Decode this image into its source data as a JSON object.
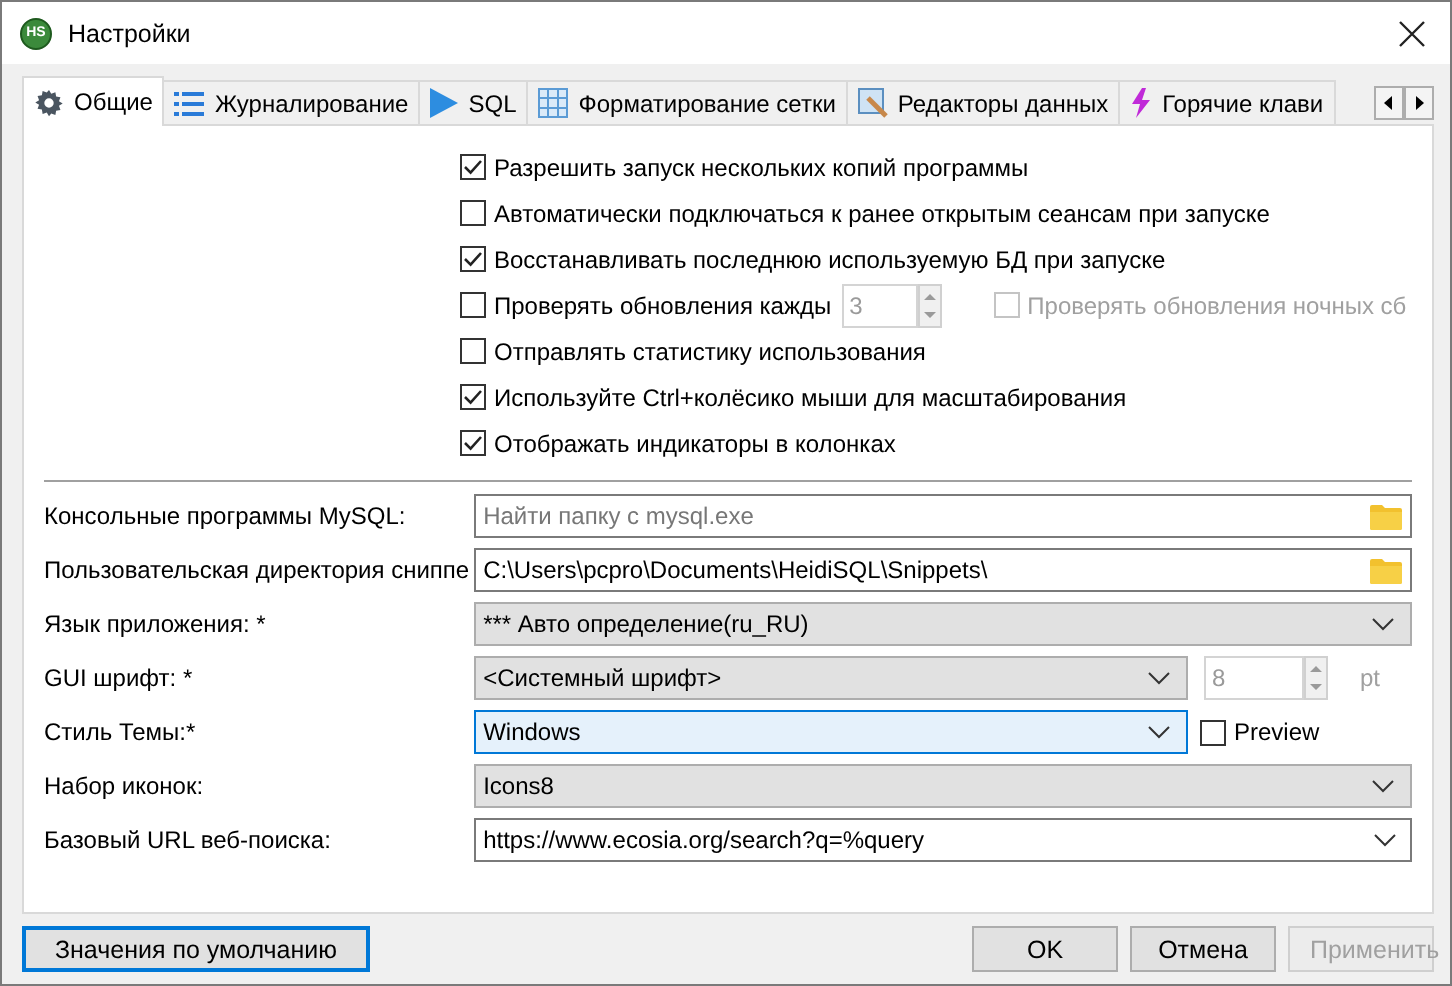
{
  "window": {
    "title": "Настройки",
    "icon_text": "HS"
  },
  "tabs": [
    {
      "label": "Общие",
      "selected": true
    },
    {
      "label": "Журналирование",
      "selected": false
    },
    {
      "label": "SQL",
      "selected": false
    },
    {
      "label": "Форматирование сетки",
      "selected": false
    },
    {
      "label": "Редакторы данных",
      "selected": false
    },
    {
      "label": "Горячие клави",
      "selected": false
    }
  ],
  "checkboxes": [
    {
      "label": "Разрешить запуск нескольких копий программы",
      "checked": true
    },
    {
      "label": "Автоматически подключаться к ранее открытым сеансам при запуске",
      "checked": false
    },
    {
      "label": "Восстанавливать последнюю используемую БД при запуске",
      "checked": true
    },
    {
      "label": "Проверять обновления кажды",
      "checked": false,
      "spin": {
        "value": "3",
        "disabled": true
      },
      "extra": {
        "label": "Проверять обновления ночных сб",
        "checked": false,
        "disabled": true
      }
    },
    {
      "label": "Отправлять статистику использования",
      "checked": false
    },
    {
      "label": "Используйте Ctrl+колёсико мыши для масштабирования",
      "checked": true
    },
    {
      "label": "Отображать индикаторы в колонках",
      "checked": true
    }
  ],
  "fields": [
    {
      "label": "Консольные программы MySQL:",
      "kind": "folder",
      "placeholder": "Найти папку с mysql.exe",
      "focused": false
    },
    {
      "label": "Пользовательская директория сниппе",
      "kind": "folder",
      "value": "C:\\Users\\pcpro\\Documents\\HeidiSQL\\Snippets\\",
      "focused": false
    },
    {
      "label": "Язык приложения: *",
      "kind": "select",
      "value": "*** Авто определение(ru_RU)",
      "focused": false
    },
    {
      "label": "GUI шрифт: *",
      "kind": "font",
      "value": "<Системный шрифт>",
      "focused": false,
      "size": {
        "value": "8",
        "disabled": true
      },
      "unit": "pt"
    },
    {
      "label": "Стиль Темы:*",
      "kind": "theme",
      "value": "Windows",
      "focused": true,
      "preview": {
        "label": "Preview",
        "checked": false
      }
    },
    {
      "label": "Набор иконок:",
      "kind": "select",
      "value": "Icons8",
      "focused": false
    },
    {
      "label": "Базовый URL веб-поиска:",
      "kind": "combo",
      "value": "https://www.ecosia.org/search?q=%query",
      "focused": false
    }
  ],
  "buttons": [
    {
      "label": "Значения по умолчанию",
      "focused": true,
      "disabled": false
    },
    {
      "label": "OK",
      "focused": false,
      "disabled": false
    },
    {
      "label": "Отмена",
      "focused": false,
      "disabled": false
    },
    {
      "label": "Применить",
      "focused": false,
      "disabled": true
    }
  ]
}
